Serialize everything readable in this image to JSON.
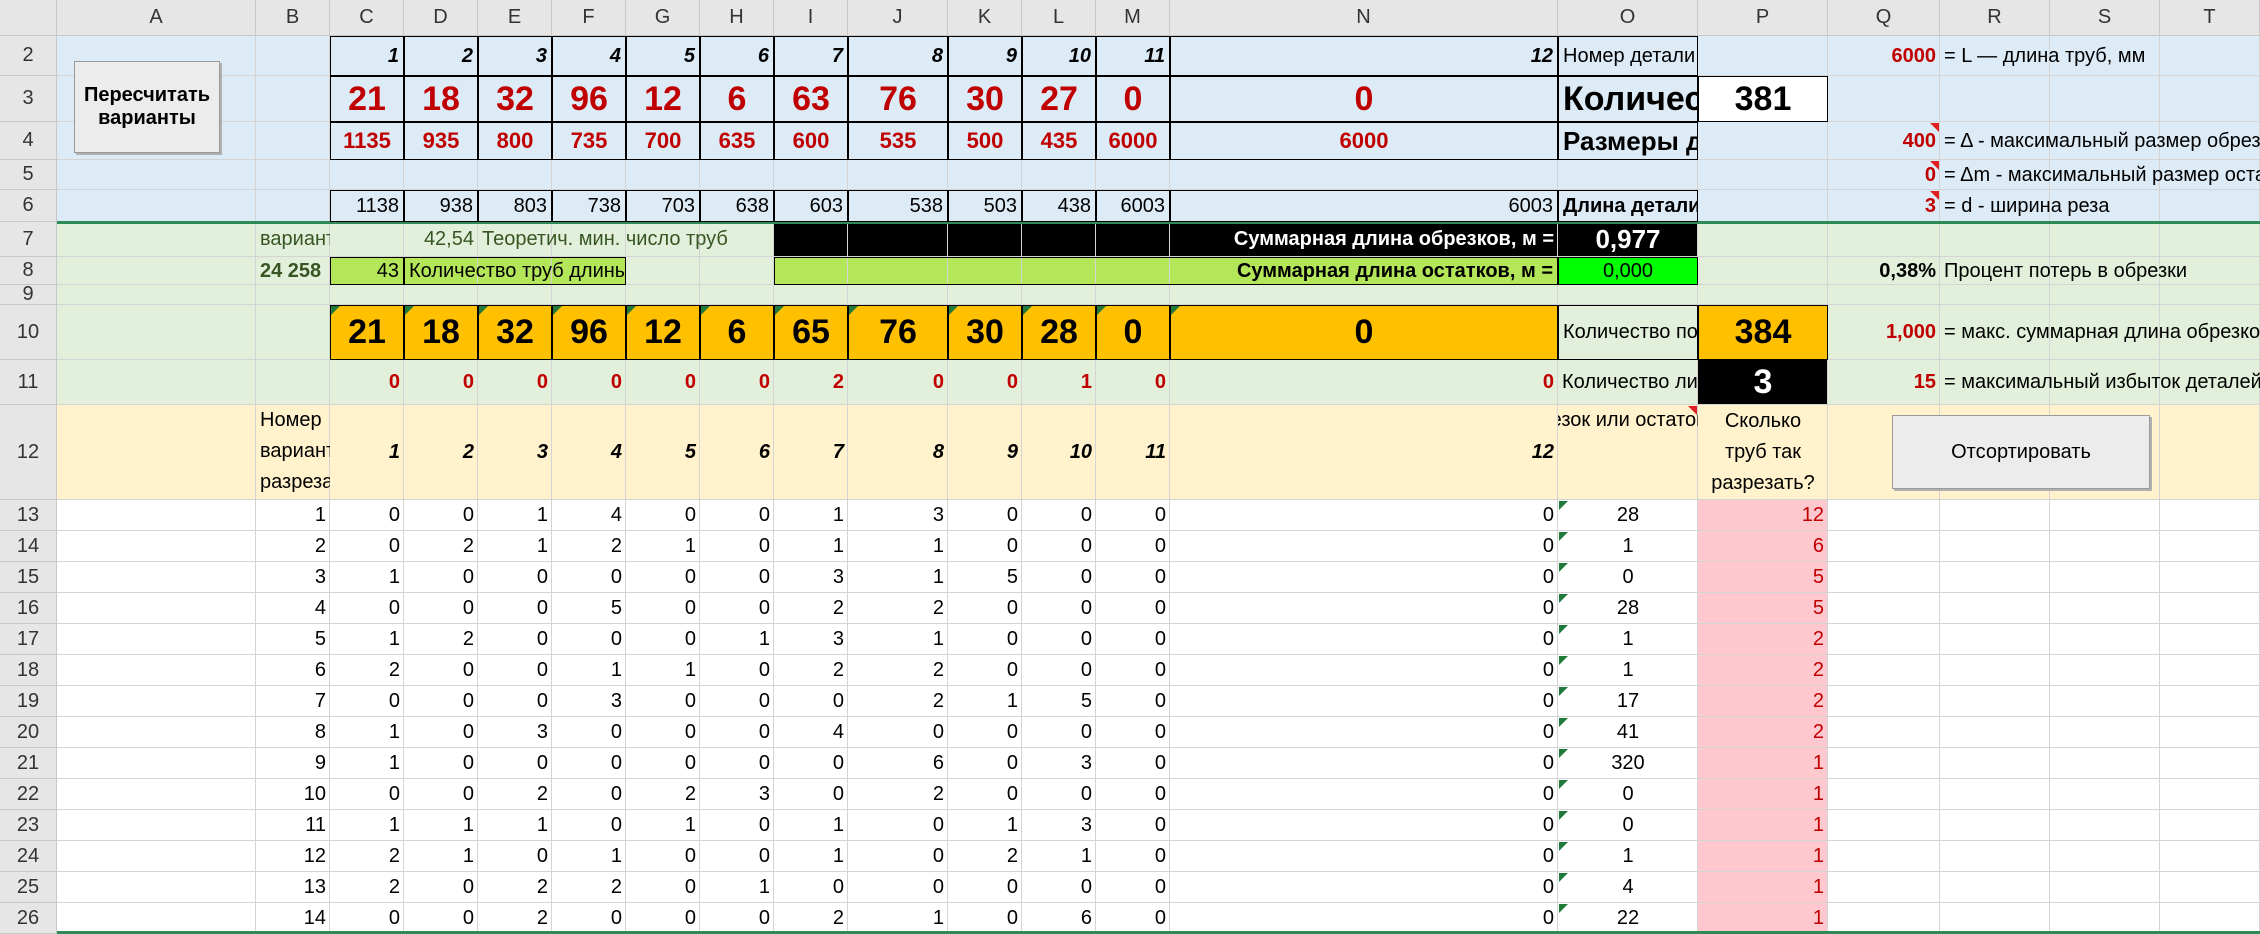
{
  "columns": [
    "A",
    "B",
    "C",
    "D",
    "E",
    "F",
    "G",
    "H",
    "I",
    "J",
    "K",
    "L",
    "M",
    "N",
    "O",
    "P",
    "Q",
    "R",
    "S",
    "T"
  ],
  "row_numbers": [
    "2",
    "3",
    "4",
    "5",
    "6",
    "7",
    "8",
    "9",
    "10",
    "11",
    "12",
    "13",
    "14",
    "15",
    "16",
    "17",
    "18",
    "19",
    "20",
    "21",
    "22",
    "23",
    "24",
    "25",
    "26"
  ],
  "buttons": {
    "recalc": "Пересчитать варианты",
    "sort": "Отсортировать"
  },
  "part_numbers": [
    "1",
    "2",
    "3",
    "4",
    "5",
    "6",
    "7",
    "8",
    "9",
    "10",
    "11",
    "12"
  ],
  "part_quantities": [
    "21",
    "18",
    "32",
    "96",
    "12",
    "6",
    "63",
    "76",
    "30",
    "27",
    "0",
    "0"
  ],
  "part_sizes": [
    "1135",
    "935",
    "800",
    "735",
    "700",
    "635",
    "600",
    "535",
    "500",
    "435",
    "6000",
    "6000"
  ],
  "part_len_with_cut": [
    "1138",
    "938",
    "803",
    "738",
    "703",
    "638",
    "603",
    "538",
    "503",
    "438",
    "6003",
    "6003"
  ],
  "labels": {
    "part_number": "Номер детали",
    "part_quantity": "Количество деталей",
    "part_sizes": "Размеры деталей, мм",
    "len_plus_cut": "Длина детали + ширина реза",
    "variants": "вариантов",
    "variants_count": "24 258",
    "theor_min_value": "42,54",
    "theor_min": "Теоретич. мин. число труб",
    "pipes_count_value": "43",
    "pipes_count": "Количество труб длины L",
    "sum_offcuts": "Суммарная длина обрезков, м =",
    "sum_offcuts_value": "0,977",
    "sum_remains": "Суммарная длина остатков, м =",
    "sum_remains_value": "0,000",
    "loss_percent_value": "0,38%",
    "loss_percent": "Процент потерь в обрезки",
    "received_parts": "Количество полученных  деталей",
    "received_total": "384",
    "extra_parts": "Количество лишних деталей",
    "extra_total": "3",
    "total_parts": "381",
    "variant_number": "Номер варианта разреза",
    "offcut_header": "Обрезок или остаток, мм",
    "pipes_header": "Сколько труб так разрезать?"
  },
  "params": [
    {
      "value": "6000",
      "label": "= L — длина труб, мм"
    },
    {
      "value": "400",
      "label": "= Δ - максимальный размер обрезка"
    },
    {
      "value": "0",
      "label": "= Δm - максимальный размер остатка"
    },
    {
      "value": "3",
      "label": "= d - ширина реза"
    },
    {
      "value": "1,000",
      "label": "= макс. суммарная длина обрезков"
    },
    {
      "value": "15",
      "label": "= максимальный избыток деталей"
    }
  ],
  "received_counts": [
    "21",
    "18",
    "32",
    "96",
    "12",
    "6",
    "65",
    "76",
    "30",
    "28",
    "0",
    "0"
  ],
  "extra_counts": [
    "0",
    "0",
    "0",
    "0",
    "0",
    "0",
    "2",
    "0",
    "0",
    "1",
    "0",
    "0"
  ],
  "header_numbers": [
    "1",
    "2",
    "3",
    "4",
    "5",
    "6",
    "7",
    "8",
    "9",
    "10",
    "11",
    "12"
  ],
  "variants": [
    {
      "n": "1",
      "cells": [
        "0",
        "0",
        "1",
        "4",
        "0",
        "0",
        "1",
        "3",
        "0",
        "0",
        "0",
        "0"
      ],
      "offcut": "28",
      "pipes": "12"
    },
    {
      "n": "2",
      "cells": [
        "0",
        "2",
        "1",
        "2",
        "1",
        "0",
        "1",
        "1",
        "0",
        "0",
        "0",
        "0"
      ],
      "offcut": "1",
      "pipes": "6"
    },
    {
      "n": "3",
      "cells": [
        "1",
        "0",
        "0",
        "0",
        "0",
        "0",
        "3",
        "1",
        "5",
        "0",
        "0",
        "0"
      ],
      "offcut": "0",
      "pipes": "5"
    },
    {
      "n": "4",
      "cells": [
        "0",
        "0",
        "0",
        "5",
        "0",
        "0",
        "2",
        "2",
        "0",
        "0",
        "0",
        "0"
      ],
      "offcut": "28",
      "pipes": "5"
    },
    {
      "n": "5",
      "cells": [
        "1",
        "2",
        "0",
        "0",
        "0",
        "1",
        "3",
        "1",
        "0",
        "0",
        "0",
        "0"
      ],
      "offcut": "1",
      "pipes": "2"
    },
    {
      "n": "6",
      "cells": [
        "2",
        "0",
        "0",
        "1",
        "1",
        "0",
        "2",
        "2",
        "0",
        "0",
        "0",
        "0"
      ],
      "offcut": "1",
      "pipes": "2"
    },
    {
      "n": "7",
      "cells": [
        "0",
        "0",
        "0",
        "3",
        "0",
        "0",
        "0",
        "2",
        "1",
        "5",
        "0",
        "0"
      ],
      "offcut": "17",
      "pipes": "2"
    },
    {
      "n": "8",
      "cells": [
        "1",
        "0",
        "3",
        "0",
        "0",
        "0",
        "4",
        "0",
        "0",
        "0",
        "0",
        "0"
      ],
      "offcut": "41",
      "pipes": "2"
    },
    {
      "n": "9",
      "cells": [
        "1",
        "0",
        "0",
        "0",
        "0",
        "0",
        "0",
        "6",
        "0",
        "3",
        "0",
        "0"
      ],
      "offcut": "320",
      "pipes": "1"
    },
    {
      "n": "10",
      "cells": [
        "0",
        "0",
        "2",
        "0",
        "2",
        "3",
        "0",
        "2",
        "0",
        "0",
        "0",
        "0"
      ],
      "offcut": "0",
      "pipes": "1"
    },
    {
      "n": "11",
      "cells": [
        "1",
        "1",
        "1",
        "0",
        "1",
        "0",
        "1",
        "0",
        "1",
        "3",
        "0",
        "0"
      ],
      "offcut": "0",
      "pipes": "1"
    },
    {
      "n": "12",
      "cells": [
        "2",
        "1",
        "0",
        "1",
        "0",
        "0",
        "1",
        "0",
        "2",
        "1",
        "0",
        "0"
      ],
      "offcut": "1",
      "pipes": "1"
    },
    {
      "n": "13",
      "cells": [
        "2",
        "0",
        "2",
        "2",
        "0",
        "1",
        "0",
        "0",
        "0",
        "0",
        "0",
        "0"
      ],
      "offcut": "4",
      "pipes": "1"
    },
    {
      "n": "14",
      "cells": [
        "0",
        "0",
        "2",
        "0",
        "0",
        "0",
        "2",
        "1",
        "0",
        "6",
        "0",
        "0"
      ],
      "offcut": "22",
      "pipes": "1"
    }
  ],
  "colors": {
    "blue_band": "#ddebf7",
    "green_band": "#e2efda",
    "orange": "#ffc000",
    "peach": "#fff2cc",
    "lime": "#b4e65a",
    "bright_green": "#00ff00",
    "pink": "#ffc7ce",
    "red_text": "#c00000"
  }
}
